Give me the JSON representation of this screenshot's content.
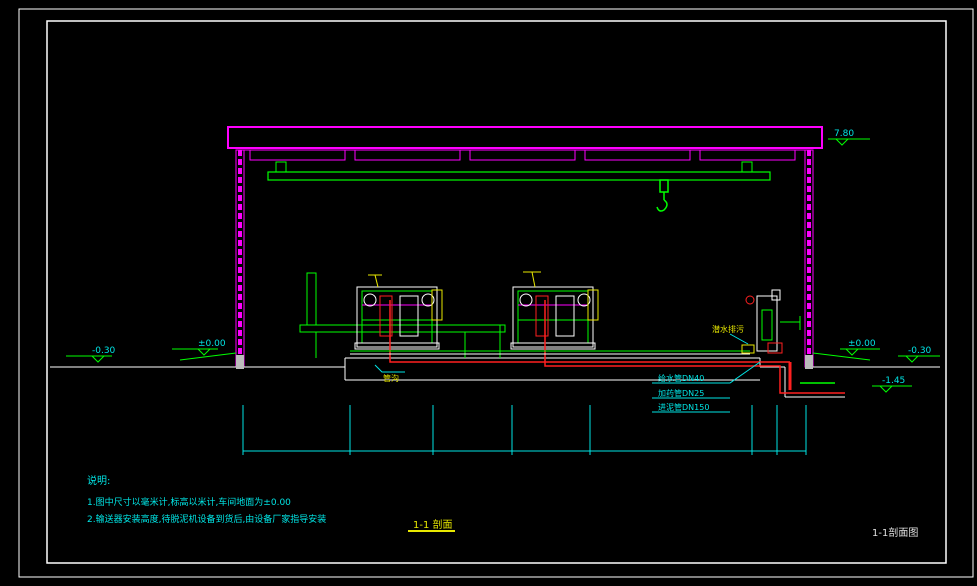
{
  "elevations": {
    "roof": "7.80",
    "left_outer": "-0.30",
    "left_floor": "±0.00",
    "right_floor": "±0.00",
    "right_outer": "-0.30",
    "pit": "-1.45"
  },
  "labels": {
    "pipe_trench": "管沟",
    "drain_pump": "潜水排污",
    "pipe_1": "给水管DN40",
    "pipe_2": "加药管DN25",
    "pipe_3": "进泥管DN150"
  },
  "notes": {
    "heading": "说明:",
    "line1": "1.图中尺寸以毫米计,标高以米计,车间地面为±0.00",
    "line2": "2.输送器安装高度,待脱泥机设备到货后,由设备厂家指导安装"
  },
  "section_title": "1-1 剖面",
  "sheet_title": "1-1剖面图",
  "colors": {
    "background": "#000000",
    "frame": "#ffffff",
    "roof": "#ff00ff",
    "structure": "#00ff00",
    "dimension": "#00e5e5",
    "pipe_red": "#ff2020",
    "annotation": "#e8e800"
  }
}
